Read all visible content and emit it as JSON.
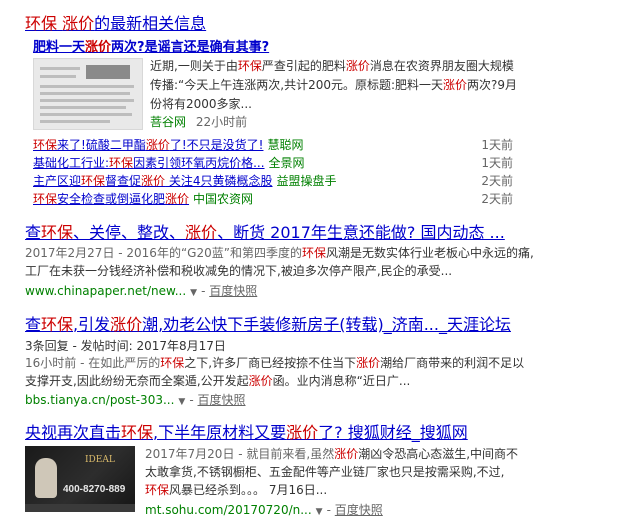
{
  "news": {
    "title_parts": [
      "环保",
      " ",
      "涨价",
      "的最新相关信息"
    ],
    "lead": {
      "title_parts": [
        "肥料一天",
        "涨价",
        "两次?是谣言还是确有其事?"
      ],
      "text_parts": [
        "近期,一则关于由",
        "环保",
        "严查引起的肥料",
        "涨价",
        "消息在农资界朋友圈大规模传播:“今天上午连涨两次,共计200元。原标题:肥料一天",
        "涨价",
        "两次?9月份将有2000多家..."
      ],
      "source": "菩谷网",
      "time": "22小时前",
      "thumb_title": "重大消息"
    },
    "items": [
      {
        "parts": [
          "环保",
          "来了!硫酸二甲酯",
          "涨价",
          "了!不只是没货了!"
        ],
        "source": "慧聪网",
        "time": "1天前"
      },
      {
        "parts": [
          "基础化工行业:",
          "环保",
          "因素引领环氧丙烷价格..."
        ],
        "source": "全景网",
        "time": "1天前"
      },
      {
        "parts": [
          "主产区迎",
          "环保",
          "督查促",
          "涨价",
          " 关注4只黄磷概念股"
        ],
        "source": "益盟操盘手",
        "time": "2天前"
      },
      {
        "parts": [
          "环保",
          "安全检查或倒逼化肥",
          "涨价"
        ],
        "source": "中国农资网",
        "time": "2天前"
      }
    ]
  },
  "results": [
    {
      "title_parts": [
        "查",
        "环保",
        "、关停、整改、",
        "涨价",
        "、断货 2017年生意还能做? 国内动态 ..."
      ],
      "lines": [
        [
          "2017年2月27日 - 2016年的“G20蓝”和第四季度的",
          "环保",
          "风潮是无数实体行业老板心中永远的痛,"
        ],
        [
          "工厂在未获一分钱经济补偿和税收减免的情况下,被迫多次停产限产,民企的承受..."
        ]
      ],
      "url": "www.chinapaper.net/new...",
      "snapshot": "百度快照"
    },
    {
      "title_parts": [
        "查",
        "环保",
        ",引发",
        "涨价",
        "潮,劝老公快下手装修新房子(转载)_济南..._天涯论坛"
      ],
      "meta": "3条回复 - 发帖时间: 2017年8月17日",
      "lines": [
        [
          "16小时前 - 在如此严厉的",
          "环保",
          "之下,许多厂商已经按捺不住当下",
          "涨价",
          "潮给厂商带来的利润不足以"
        ],
        [
          "支撑开支,因此纷纷无奈而全案遁,公开发起",
          "涨价",
          "函。业内消息称“近日广..."
        ]
      ],
      "url": "bbs.tianya.cn/post-303...",
      "snapshot": "百度快照"
    },
    {
      "title_parts": [
        "央视再次直击",
        "环保",
        ",下半年原材料又要",
        "涨价",
        "了? 搜狐财经_搜狐网"
      ],
      "lines": [
        [
          "2017年7月20日 - 就目前来看,虽然",
          "涨价",
          "潮凶令恐高心态滋生,中间商不"
        ],
        [
          "太敢拿货,不锈钢橱柜、五金配件等产业链厂家也只是按需采购,不过,"
        ],
        [
          "环保",
          "风暴已经杀到。。。 7月16日..."
        ]
      ],
      "url": "mt.sohu.com/20170720/n...",
      "snapshot": "百度快照",
      "thumb": {
        "logo": "IDEAL",
        "phone": "400-8270-889"
      }
    }
  ]
}
